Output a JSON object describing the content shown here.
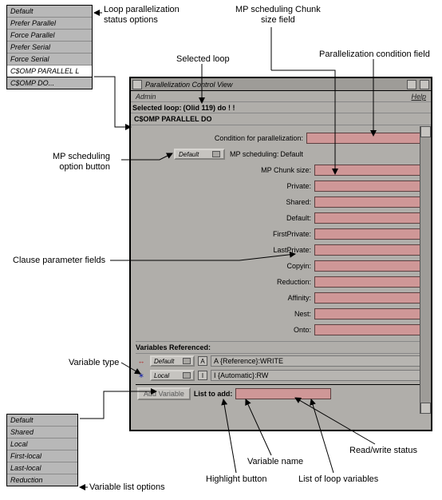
{
  "callouts": {
    "loop_status_options": "Loop parallelization\nstatus options",
    "mp_chunk_field": "MP scheduling Chunk\nsize field",
    "selected_loop": "Selected loop",
    "parallel_cond_field": "Parallelization condition field",
    "mp_option_button": "MP scheduling\noption button",
    "clause_param_fields": "Clause parameter fields",
    "variable_type": "Variable type",
    "variable_name": "Variable name",
    "rw_status": "Read/write status",
    "highlight_button": "Highlight button",
    "list_of_loop_vars": "List of loop variables",
    "variable_list_options": "Variable list options"
  },
  "top_option_list": [
    "Default",
    "Prefer Parallel",
    "Force Parallel",
    "Prefer Serial",
    "Force Serial",
    "C$OMP PARALLEL L",
    "C$OMP DO..."
  ],
  "top_option_selected_index": 5,
  "bottom_option_list": [
    "Default",
    "Shared",
    "Local",
    "First-local",
    "Last-local",
    "Reduction"
  ],
  "window": {
    "title": "Parallelization Control View",
    "menu": {
      "left": "Admin",
      "right": "Help"
    },
    "selected_loop_label": "Selected loop:",
    "selected_loop_value": "(Olid 119) do ! !",
    "directive_line": "C$OMP PARALLEL DO",
    "condition_label": "Condition for parallelization:",
    "mp_scheduling_button": "Default",
    "mp_scheduling_label": "MP scheduling:",
    "mp_scheduling_value": "Default",
    "mp_chunk_label": "MP Chunk size:",
    "clause_labels": [
      "Private:",
      "Shared:",
      "Default:",
      "FirstPrivate:",
      "LastPrivate:",
      "Copyin:",
      "Reduction:",
      "Affinity:",
      "Nest:",
      "Onto:"
    ],
    "vars_title": "Variables Referenced:",
    "var_rows": [
      {
        "icon": "↔",
        "icon_color": "#b02020",
        "button": "Default",
        "highlight": "A",
        "text": "A {Reference}:WRITE"
      },
      {
        "icon": "∗",
        "icon_color": "#1e2aa8",
        "button": "Local",
        "highlight": "I",
        "text": "I {Automatic}:RW"
      }
    ],
    "bottom": {
      "add_variable": "Add Variable",
      "list_to_add": "List to add:"
    }
  }
}
